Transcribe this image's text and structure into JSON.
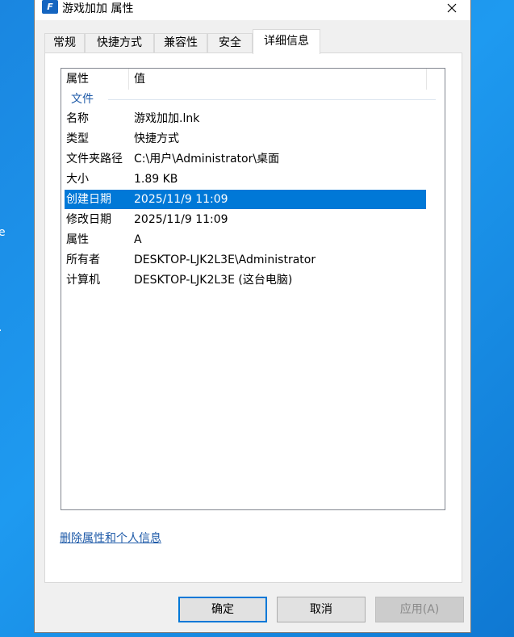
{
  "desktop": {
    "fragment1": "e",
    "fragment2": "."
  },
  "window": {
    "title": "游戏加加 属性",
    "icon": "app-logo-icon",
    "close": "close-icon"
  },
  "tabs": [
    {
      "label": "常规"
    },
    {
      "label": "快捷方式"
    },
    {
      "label": "兼容性"
    },
    {
      "label": "安全"
    },
    {
      "label": "详细信息",
      "active": true
    }
  ],
  "listview": {
    "columns": [
      "属性",
      "值"
    ],
    "group": "文件",
    "rows": [
      {
        "key": "名称",
        "value": "游戏加加.lnk"
      },
      {
        "key": "类型",
        "value": "快捷方式"
      },
      {
        "key": "文件夹路径",
        "value": "C:\\用户\\Administrator\\桌面"
      },
      {
        "key": "大小",
        "value": "1.89 KB"
      },
      {
        "key": "创建日期",
        "value": "2025/11/9 11:09",
        "selected": true
      },
      {
        "key": "修改日期",
        "value": "2025/11/9 11:09"
      },
      {
        "key": "属性",
        "value": "A"
      },
      {
        "key": "所有者",
        "value": "DESKTOP-LJK2L3E\\Administrator"
      },
      {
        "key": "计算机",
        "value": "DESKTOP-LJK2L3E (这台电脑)"
      }
    ]
  },
  "link": "删除属性和个人信息",
  "buttons": {
    "ok": "确定",
    "cancel": "取消",
    "apply": "应用(A)"
  },
  "colors": {
    "selection": "#0078d7",
    "link": "#1e5aa8",
    "desktop": "#1a86e0"
  }
}
